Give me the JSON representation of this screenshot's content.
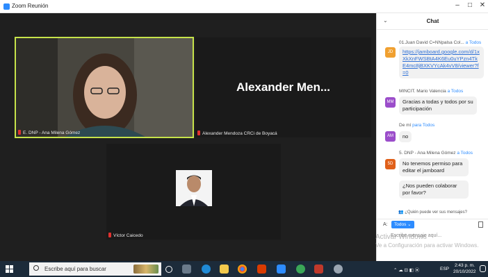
{
  "window": {
    "title": "Zoom Reunión",
    "minimize": "–",
    "maximize": "□",
    "close": "✕"
  },
  "video": {
    "tiles": [
      {
        "label": "E. DNP - Ana Milena Gómez"
      },
      {
        "label": "Alexander Mendoza CRCi de Boyacá",
        "display_name": "Alexander Men..."
      },
      {
        "label": "Víctor Caicedo"
      }
    ]
  },
  "chat": {
    "title": "Chat",
    "collapse_icon": "chevron-down-icon",
    "messages": [
      {
        "meta_from": "01.Juan David C=NNpalsa Col...",
        "meta_to": "a Todos",
        "avatar": "JD",
        "avatar_color": "#f0a030",
        "text": "https://jamboard.google.com/d/1xXkXnFWSBtA4K6Eu0uYPzn4TkE4mc8jBXKVYcAk4vV8/viewer?f=0",
        "is_link": true
      },
      {
        "meta_from": "MINCIT. Mario Valencia",
        "meta_to": "a Todos",
        "avatar": "MM",
        "avatar_color": "#9b4dca",
        "text": "Gracias a todas y todos por su participación"
      },
      {
        "meta_from": "De mí",
        "meta_to": "para Todos",
        "avatar": "AM",
        "avatar_color": "#9b4dca",
        "text": "no"
      },
      {
        "meta_from": "5. DNP - Ana Milena Gómez",
        "meta_to": "a Todos",
        "avatar": "5D",
        "avatar_color": "#e0601a",
        "text": "No tenemos permiso para editar el jamboard"
      },
      {
        "text": "¿Nos pueden colaborar por favor?"
      }
    ],
    "who_can_see": "¿Quién puede ver sus mensajes?",
    "to_label": "A:",
    "to_button": "Todos",
    "input_placeholder": "Escribe mensaje aquí..."
  },
  "watermark": {
    "line1": "Activar Windows",
    "line2": "Ve a Configuración para activar Windows."
  },
  "taskbar": {
    "search_placeholder": "Escribe aquí para buscar",
    "icons": [
      "circle-icon",
      "task-view-icon",
      "edge-icon",
      "file-explorer-icon",
      "chrome-icon",
      "office-icon",
      "zoom-icon",
      "app-icon",
      "app-icon-2",
      "app-icon-3"
    ],
    "tray_lang": "ESP",
    "time": "2:43 p. m.",
    "date": "20/10/2022"
  }
}
